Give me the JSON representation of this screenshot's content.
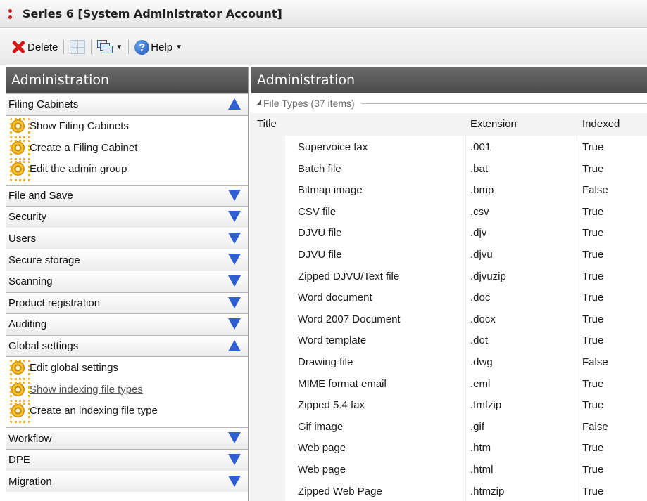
{
  "window": {
    "title": "Series 6 [System Administrator Account]"
  },
  "toolbar": {
    "delete_label": "Delete",
    "help_label": "Help"
  },
  "left_panel": {
    "title": "Administration",
    "sections": [
      {
        "label": "Filing Cabinets",
        "expanded": true,
        "tasks": [
          {
            "label": "Show Filing Cabinets"
          },
          {
            "label": "Create a Filing Cabinet"
          },
          {
            "label": "Edit the admin group"
          }
        ]
      },
      {
        "label": "File and Save",
        "expanded": false
      },
      {
        "label": "Security",
        "expanded": false
      },
      {
        "label": "Users",
        "expanded": false
      },
      {
        "label": "Secure storage",
        "expanded": false
      },
      {
        "label": "Scanning",
        "expanded": false
      },
      {
        "label": "Product registration",
        "expanded": false
      },
      {
        "label": "Auditing",
        "expanded": false
      },
      {
        "label": "Global settings",
        "expanded": true,
        "tasks": [
          {
            "label": "Edit global settings"
          },
          {
            "label": "Show indexing file types",
            "active": true
          },
          {
            "label": "Create an indexing file type"
          }
        ]
      },
      {
        "label": "Workflow",
        "expanded": false
      },
      {
        "label": "DPE",
        "expanded": false
      },
      {
        "label": "Migration",
        "expanded": false
      }
    ]
  },
  "right_panel": {
    "title": "Administration",
    "group_label": "File Types (37 items)",
    "columns": {
      "title": "Title",
      "extension": "Extension",
      "indexed": "Indexed"
    },
    "rows": [
      {
        "title": "Supervoice fax",
        "extension": ".001",
        "indexed": "True"
      },
      {
        "title": "Batch file",
        "extension": ".bat",
        "indexed": "True"
      },
      {
        "title": "Bitmap image",
        "extension": ".bmp",
        "indexed": "False"
      },
      {
        "title": "CSV file",
        "extension": ".csv",
        "indexed": "True"
      },
      {
        "title": "DJVU file",
        "extension": ".djv",
        "indexed": "True"
      },
      {
        "title": "DJVU file",
        "extension": ".djvu",
        "indexed": "True"
      },
      {
        "title": "Zipped DJVU/Text file",
        "extension": ".djvuzip",
        "indexed": "True"
      },
      {
        "title": "Word document",
        "extension": ".doc",
        "indexed": "True"
      },
      {
        "title": "Word 2007 Document",
        "extension": ".docx",
        "indexed": "True"
      },
      {
        "title": "Word template",
        "extension": ".dot",
        "indexed": "True"
      },
      {
        "title": "Drawing file",
        "extension": ".dwg",
        "indexed": "False"
      },
      {
        "title": "MIME format email",
        "extension": ".eml",
        "indexed": "True"
      },
      {
        "title": "Zipped 5.4 fax",
        "extension": ".fmfzip",
        "indexed": "True"
      },
      {
        "title": "Gif image",
        "extension": ".gif",
        "indexed": "False"
      },
      {
        "title": "Web page",
        "extension": ".htm",
        "indexed": "True"
      },
      {
        "title": "Web page",
        "extension": ".html",
        "indexed": "True"
      },
      {
        "title": "Zipped Web Page",
        "extension": ".htmzip",
        "indexed": "True"
      }
    ]
  },
  "colors": {
    "panel_header": "#5a5a5a",
    "chevron": "#2f5fd0",
    "delete_icon": "#d51616"
  }
}
